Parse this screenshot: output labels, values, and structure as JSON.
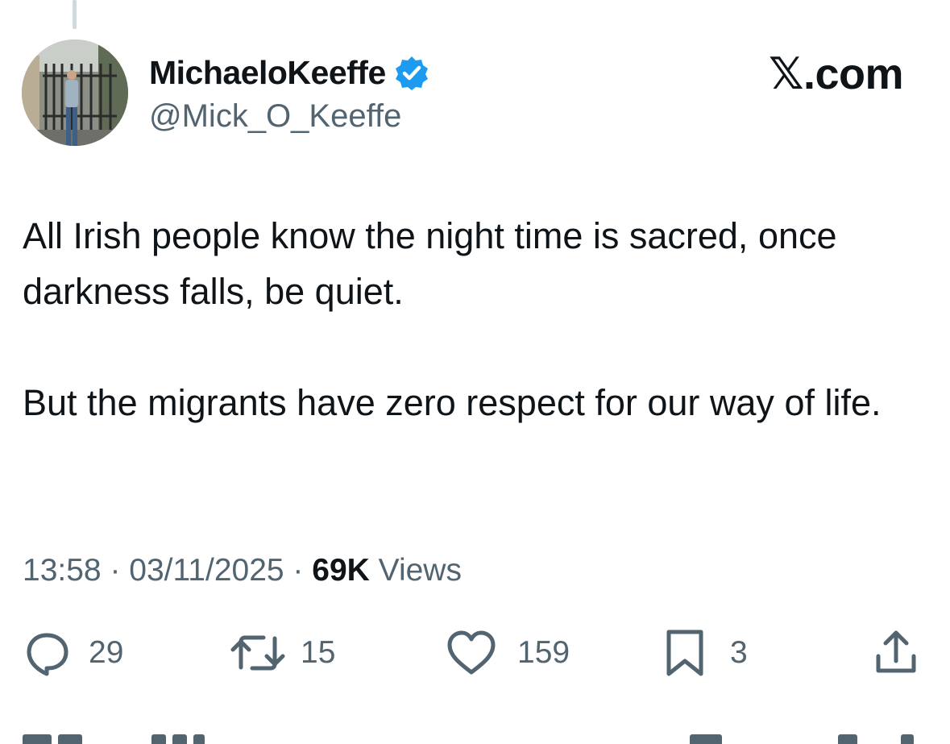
{
  "author": {
    "display_name": "MichaeloKeeffe",
    "handle": "@Mick_O_Keeffe",
    "verified": true,
    "verified_color": "#1d9bf0"
  },
  "brand": "𝕏.com",
  "tweet": {
    "paragraph1": "All Irish people know the night time is sacred, once darkness falls, be quiet.",
    "paragraph2": "But the migrants have zero respect for our way of life."
  },
  "meta": {
    "time": "13:58",
    "separator": " · ",
    "date": "03/11/2025",
    "views_count": "69K",
    "views_label": "Views"
  },
  "actions": {
    "replies": {
      "icon": "reply-icon",
      "count": "29"
    },
    "reposts": {
      "icon": "repost-icon",
      "count": "15"
    },
    "likes": {
      "icon": "heart-icon",
      "count": "159"
    },
    "bookmarks": {
      "icon": "bookmark-icon",
      "count": "3"
    },
    "share": {
      "icon": "share-icon"
    }
  },
  "colors": {
    "text_primary": "#0f1419",
    "text_secondary": "#536471",
    "thread_line": "#cfd9de"
  }
}
